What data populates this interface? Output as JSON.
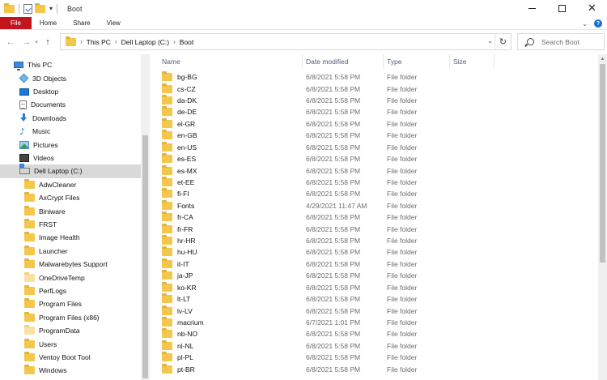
{
  "window": {
    "title": "Boot",
    "minimize": "",
    "maximize": "",
    "close": "✕"
  },
  "ribbon": {
    "tabs": [
      "File",
      "Home",
      "Share",
      "View"
    ]
  },
  "address": {
    "crumbs": [
      "This PC",
      "Dell Laptop (C:)",
      "Boot"
    ]
  },
  "search": {
    "placeholder": "Search Boot"
  },
  "nav_pane": {
    "items": [
      {
        "label": "This PC",
        "icon": "pc-icon",
        "level": 0
      },
      {
        "label": "3D Objects",
        "icon": "cube-icon",
        "level": 1
      },
      {
        "label": "Desktop",
        "icon": "desktop-icon",
        "level": 1
      },
      {
        "label": "Documents",
        "icon": "document-icon",
        "level": 1
      },
      {
        "label": "Downloads",
        "icon": "download-icon",
        "level": 1
      },
      {
        "label": "Music",
        "icon": "music-icon",
        "level": 1
      },
      {
        "label": "Pictures",
        "icon": "picture-icon",
        "level": 1
      },
      {
        "label": "Videos",
        "icon": "video-icon",
        "level": 1
      },
      {
        "label": "Dell Laptop (C:)",
        "icon": "drive-icon",
        "level": 1,
        "selected": true
      },
      {
        "label": "AdwCleaner",
        "icon": "folder-icon",
        "level": 2
      },
      {
        "label": "AxCrypt Files",
        "icon": "folder-icon",
        "level": 2
      },
      {
        "label": "Biniware",
        "icon": "folder-icon",
        "level": 2
      },
      {
        "label": "FRST",
        "icon": "folder-icon",
        "level": 2
      },
      {
        "label": "Image Health",
        "icon": "folder-icon",
        "level": 2
      },
      {
        "label": "Launcher",
        "icon": "folder-icon",
        "level": 2
      },
      {
        "label": "Malwarebytes Support",
        "icon": "folder-icon",
        "level": 2
      },
      {
        "label": "OneDriveTemp",
        "icon": "pale-folder-icon",
        "level": 2
      },
      {
        "label": "PerfLogs",
        "icon": "folder-icon",
        "level": 2
      },
      {
        "label": "Program Files",
        "icon": "folder-icon",
        "level": 2
      },
      {
        "label": "Program Files (x86)",
        "icon": "folder-icon",
        "level": 2
      },
      {
        "label": "ProgramData",
        "icon": "pale-folder-icon",
        "level": 2
      },
      {
        "label": "Users",
        "icon": "folder-icon",
        "level": 2
      },
      {
        "label": "Ventoy Boot Tool",
        "icon": "folder-icon",
        "level": 2
      },
      {
        "label": "Windows",
        "icon": "folder-icon",
        "level": 2
      }
    ]
  },
  "columns": {
    "name": "Name",
    "date": "Date modified",
    "type": "Type",
    "size": "Size"
  },
  "files": [
    {
      "name": "bg-BG",
      "date": "6/8/2021 5:58 PM",
      "type": "File folder"
    },
    {
      "name": "cs-CZ",
      "date": "6/8/2021 5:58 PM",
      "type": "File folder"
    },
    {
      "name": "da-DK",
      "date": "6/8/2021 5:58 PM",
      "type": "File folder"
    },
    {
      "name": "de-DE",
      "date": "6/8/2021 5:58 PM",
      "type": "File folder"
    },
    {
      "name": "el-GR",
      "date": "6/8/2021 5:58 PM",
      "type": "File folder"
    },
    {
      "name": "en-GB",
      "date": "6/8/2021 5:58 PM",
      "type": "File folder"
    },
    {
      "name": "en-US",
      "date": "6/8/2021 5:58 PM",
      "type": "File folder"
    },
    {
      "name": "es-ES",
      "date": "6/8/2021 5:58 PM",
      "type": "File folder"
    },
    {
      "name": "es-MX",
      "date": "6/8/2021 5:58 PM",
      "type": "File folder"
    },
    {
      "name": "et-EE",
      "date": "6/8/2021 5:58 PM",
      "type": "File folder"
    },
    {
      "name": "fi-FI",
      "date": "6/8/2021 5:58 PM",
      "type": "File folder"
    },
    {
      "name": "Fonts",
      "date": "4/29/2021 11:47 AM",
      "type": "File folder"
    },
    {
      "name": "fr-CA",
      "date": "6/8/2021 5:58 PM",
      "type": "File folder"
    },
    {
      "name": "fr-FR",
      "date": "6/8/2021 5:58 PM",
      "type": "File folder"
    },
    {
      "name": "hr-HR",
      "date": "6/8/2021 5:58 PM",
      "type": "File folder"
    },
    {
      "name": "hu-HU",
      "date": "6/8/2021 5:58 PM",
      "type": "File folder"
    },
    {
      "name": "it-IT",
      "date": "6/8/2021 5:58 PM",
      "type": "File folder"
    },
    {
      "name": "ja-JP",
      "date": "6/8/2021 5:58 PM",
      "type": "File folder"
    },
    {
      "name": "ko-KR",
      "date": "6/8/2021 5:58 PM",
      "type": "File folder"
    },
    {
      "name": "lt-LT",
      "date": "6/8/2021 5:58 PM",
      "type": "File folder"
    },
    {
      "name": "lv-LV",
      "date": "6/8/2021 5:58 PM",
      "type": "File folder"
    },
    {
      "name": "macrium",
      "date": "6/7/2021 1:01 PM",
      "type": "File folder"
    },
    {
      "name": "nb-NO",
      "date": "6/8/2021 5:58 PM",
      "type": "File folder"
    },
    {
      "name": "nl-NL",
      "date": "6/8/2021 5:58 PM",
      "type": "File folder"
    },
    {
      "name": "pl-PL",
      "date": "6/8/2021 5:58 PM",
      "type": "File folder"
    },
    {
      "name": "pt-BR",
      "date": "6/8/2021 5:58 PM",
      "type": "File folder"
    }
  ],
  "colors": {
    "file_tab": "#c3151e",
    "folder": "#f3c74c",
    "selected_row": "#d9d9d9",
    "header_text": "#4d6082"
  }
}
